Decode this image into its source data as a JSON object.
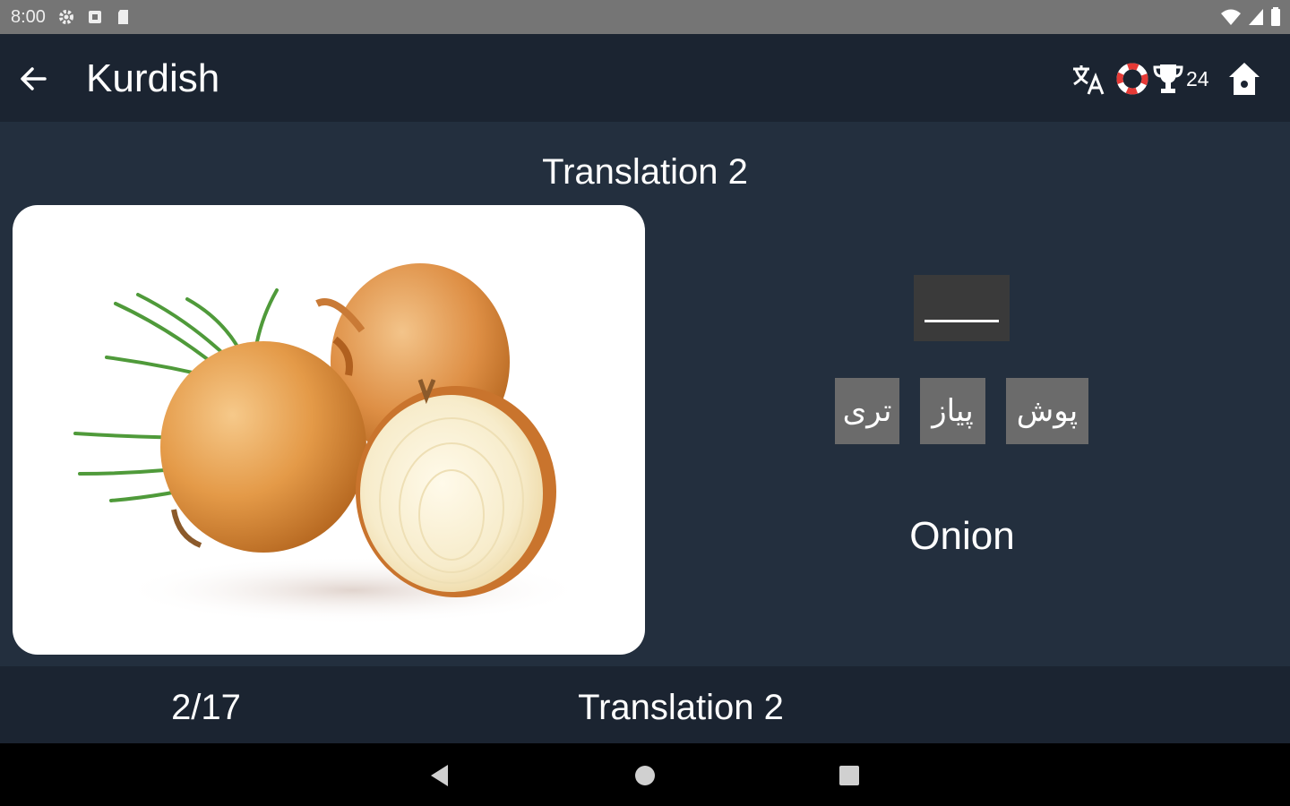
{
  "status_bar": {
    "time": "8:00",
    "icons_left": [
      "settings-icon",
      "notification-icon",
      "sd-card-icon"
    ],
    "icons_right": [
      "wifi-icon",
      "signal-icon",
      "battery-icon"
    ]
  },
  "app_bar": {
    "title": "Kurdish",
    "actions": {
      "translate": "translate-icon",
      "lifebuoy": "lifebuoy-icon",
      "trophy": "trophy-icon",
      "trophy_count": "24",
      "home": "home-icon"
    }
  },
  "lesson": {
    "title": "Translation 2",
    "image": "onion-image",
    "answer_slot": "",
    "choices": [
      "تری",
      "پیاز",
      "پوش"
    ],
    "english_word": "Onion"
  },
  "bottom_bar": {
    "progress": "2/17",
    "label": "Translation 2"
  },
  "colors": {
    "app_bar": "#1b2431",
    "content": "#232f3e",
    "choice": "#6b6b6b",
    "slot": "#3a3a3a"
  }
}
